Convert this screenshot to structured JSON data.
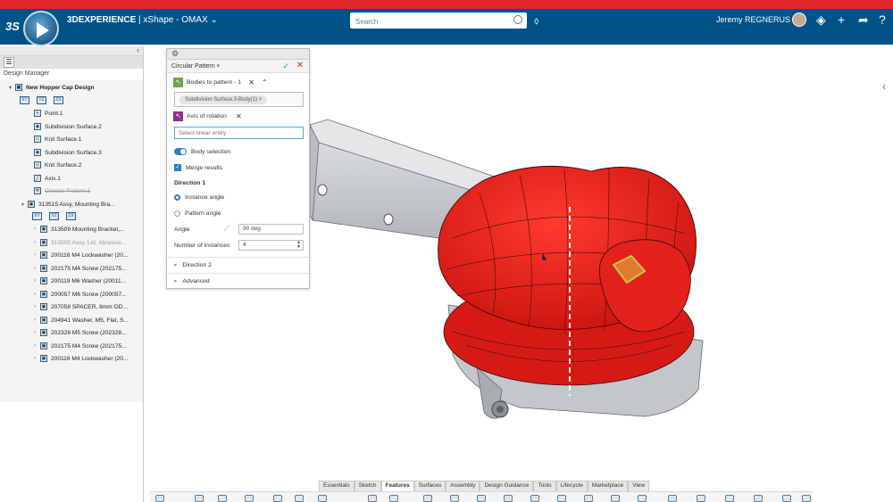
{
  "header": {
    "ds_logo": "3S",
    "brand": "3DEXPERIENCE",
    "separator": "|",
    "app": "xShape - OMAX",
    "app_chevron": "⌄",
    "search_placeholder": "Search",
    "user_name": "Jeremy REGNERUS",
    "icons": [
      "compass-icon",
      "search-icon",
      "tag-icon",
      "avatar",
      "share-icon",
      "add-icon",
      "forward-icon",
      "help-icon"
    ]
  },
  "left": {
    "title": "Design Manager",
    "tree": [
      {
        "label": "New Hopper Cap Design",
        "level": 0,
        "bold": true
      },
      {
        "label": "Point.1",
        "level": 2
      },
      {
        "label": "Subdivision Surface.2",
        "level": 2
      },
      {
        "label": "Knit Surface.1",
        "level": 2
      },
      {
        "label": "Subdivision Surface.3",
        "level": 2
      },
      {
        "label": "Knit Surface.2",
        "level": 2
      },
      {
        "label": "Axis.1",
        "level": 2
      },
      {
        "label": "Circular Pattern.1",
        "level": 2,
        "style": "strike"
      },
      {
        "label": "313515 Assy, Mounting Bra...",
        "level": 1
      },
      {
        "label": "313509 Mounting Bracket,...",
        "level": 2
      },
      {
        "label": "313505 Assy, Lid, Abrasive...",
        "level": 2,
        "style": "grey"
      },
      {
        "label": "200116 M4 Lockwasher (20...",
        "level": 2
      },
      {
        "label": "202175 M4 Screw (202175...",
        "level": 2
      },
      {
        "label": "200119 M6 Washer (20011...",
        "level": 2
      },
      {
        "label": "200057 M6 Screw (200057...",
        "level": 2
      },
      {
        "label": "207058 SPACER, 8mm OD...",
        "level": 2
      },
      {
        "label": "204941 Washer, M5, Flat, S...",
        "level": 2
      },
      {
        "label": "202328 M5 Screw (202328...",
        "level": 2
      },
      {
        "label": "202175 M4 Screw (202175...",
        "level": 2
      },
      {
        "label": "200116 M4 Lockwasher (20...",
        "level": 2
      }
    ]
  },
  "panel": {
    "title": "Circular Pattern",
    "title_chevron": "▾",
    "ok": "✓",
    "cancel": "✕",
    "bodies_label": "Bodies to pattern - 1",
    "bodies_clear": "✕",
    "bodies_collapse": "⌃",
    "chip": "Subdivision Surface.3-Body(1)",
    "chip_close": "×",
    "axis_label": "Axis of rotation",
    "axis_clear": "✕",
    "linear_placeholder": "Select linear entity",
    "body_selection": "Body selection",
    "merge_results": "Merge results",
    "direction1": "Direction 1",
    "instance_angle": "Instance angle",
    "pattern_angle": "Pattern angle",
    "angle_label": "Angle",
    "angle_value": "90 deg",
    "instances_label": "Number of instances",
    "instances_value": "4",
    "direction2": "Direction 2",
    "advanced": "Advanced"
  },
  "tabs": [
    "Essentials",
    "Sketch",
    "Features",
    "Surfaces",
    "Assembly",
    "Design Guidance",
    "Tools",
    "Lifecycle",
    "Marketplace",
    "View"
  ],
  "active_tab": "Features",
  "colors": {
    "topbar": "#005386",
    "stripe": "#e0262b",
    "model_red": "#e8201e",
    "model_grey": "#c8cbce",
    "accent": "#2f7ec1"
  }
}
